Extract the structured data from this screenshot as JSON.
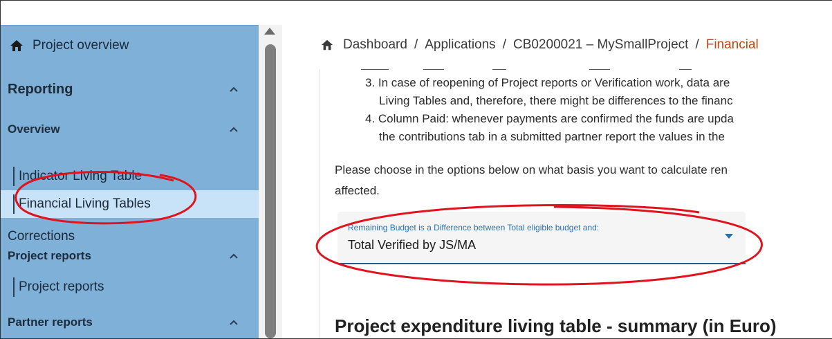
{
  "sidebar": {
    "home_label": "Project overview",
    "sections": [
      {
        "label": "Reporting"
      },
      {
        "label": "Overview"
      },
      {
        "label": "Project reports"
      },
      {
        "label": "Partner reports"
      }
    ],
    "items": {
      "indicator_living_table": "Indicator Living Table",
      "financial_living_tables": "Financial Living Tables",
      "corrections": "Corrections",
      "project_reports": "Project reports"
    }
  },
  "breadcrumb": {
    "items": [
      "Dashboard",
      "Applications",
      "CB0200021 – MySmallProject"
    ],
    "current": "Financial",
    "separator": "/"
  },
  "content": {
    "list": [
      "3. In case of reopening of Project reports or  Verification work, data are",
      "Living Tables and, therefore, there might be differences to the financ",
      "4. Column Paid: whenever payments are confirmed the funds are upda",
      "the contributions tab in a submitted partner report the values in the"
    ],
    "paragraph_line1": "Please choose in the options below on what basis you want to calculate ren",
    "paragraph_line2": "affected.",
    "select": {
      "label": "Remaining Budget is a Difference between Total eligible budget and:",
      "value": "Total Verified by JS/MA"
    },
    "section_title": "Project expenditure living table - summary (in Euro)"
  },
  "colors": {
    "sidebar_bg": "#7fb0d8",
    "sidebar_active": "#c8e3f7",
    "breadcrumb_current": "#c0460b",
    "select_accent": "#2472b3",
    "annotation": "#e0141e"
  },
  "icons": [
    "home-icon",
    "chevron-up-icon",
    "dropdown-arrow-icon"
  ]
}
